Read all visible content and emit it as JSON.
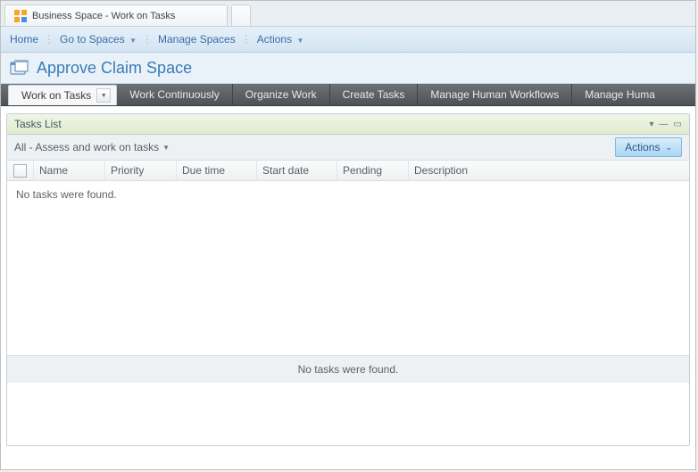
{
  "browser_tab": {
    "title": "Business Space - Work on Tasks"
  },
  "topnav": {
    "home": "Home",
    "go_to_spaces": "Go to Spaces",
    "manage_spaces": "Manage Spaces",
    "actions": "Actions"
  },
  "space": {
    "title": "Approve Claim Space"
  },
  "tabs": {
    "work_on_tasks": "Work on Tasks",
    "work_continuously": "Work Continuously",
    "organize_work": "Organize Work",
    "create_tasks": "Create Tasks",
    "manage_human_workflows": "Manage Human Workflows",
    "manage_huma_truncated": "Manage Huma"
  },
  "widget": {
    "title": "Tasks List",
    "filter_label": "All - Assess and work on tasks",
    "actions_label": "Actions",
    "columns": {
      "name": "Name",
      "priority": "Priority",
      "due_time": "Due time",
      "start_date": "Start date",
      "pending": "Pending",
      "description": "Description"
    },
    "empty_msg": "No tasks were found.",
    "footer_empty_msg": "No tasks were found."
  }
}
